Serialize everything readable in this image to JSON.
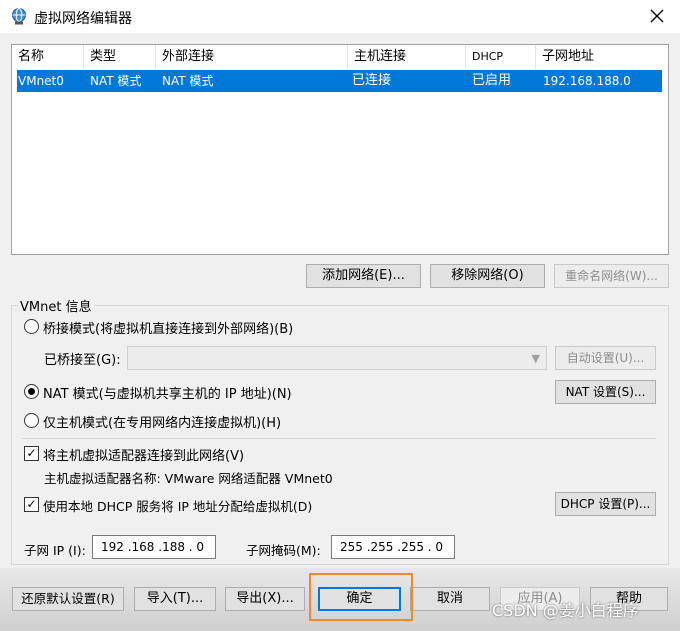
{
  "window": {
    "title": "虚拟网络编辑器",
    "icon": "network-globe-icon",
    "close_icon": "close-icon"
  },
  "list": {
    "columns": [
      "名称",
      "类型",
      "外部连接",
      "主机连接",
      "DHCP",
      "子网地址"
    ],
    "rows": [
      {
        "name": "VMnet0",
        "type": "NAT 模式",
        "external": "NAT 模式",
        "host": "已连接",
        "dhcp": "已启用",
        "subnet": "192.168.188.0"
      }
    ]
  },
  "list_buttons": {
    "add": "添加网络(E)...",
    "remove": "移除网络(O)",
    "rename": "重命名网络(W)..."
  },
  "vmnet_info": {
    "group_title": "VMnet 信息",
    "bridge_mode": "桥接模式(将虚拟机直接连接到外部网络)(B)",
    "bridged_to_label": "已桥接至(G):",
    "bridged_to_value": "",
    "auto_settings": "自动设置(U)...",
    "nat_mode": "NAT 模式(与虚拟机共享主机的 IP 地址)(N)",
    "nat_settings": "NAT 设置(S)...",
    "host_only": "仅主机模式(在专用网络内连接虚拟机)(H)",
    "selected_mode": "nat",
    "connect_host_adapter": "将主机虚拟适配器连接到此网络(V)",
    "connect_host_adapter_checked": true,
    "adapter_name_label": "主机虚拟适配器名称: VMware 网络适配器 VMnet0",
    "use_dhcp": "使用本地 DHCP 服务将 IP 地址分配给虚拟机(D)",
    "use_dhcp_checked": true,
    "dhcp_settings": "DHCP 设置(P)...",
    "subnet_ip_label": "子网 IP (I):",
    "subnet_ip_value": "192 .168 .188 . 0",
    "subnet_mask_label": "子网掩码(M):",
    "subnet_mask_value": "255 .255 .255 . 0"
  },
  "footer_buttons": {
    "restore": "还原默认设置(R)",
    "import": "导入(T)...",
    "export": "导出(X)...",
    "ok": "确定",
    "cancel": "取消",
    "apply": "应用(A)",
    "help": "帮助"
  },
  "watermark": "CSDN @姜小白程序",
  "colors": {
    "selection": "#0078d7",
    "highlight_box": "#f08a24"
  }
}
